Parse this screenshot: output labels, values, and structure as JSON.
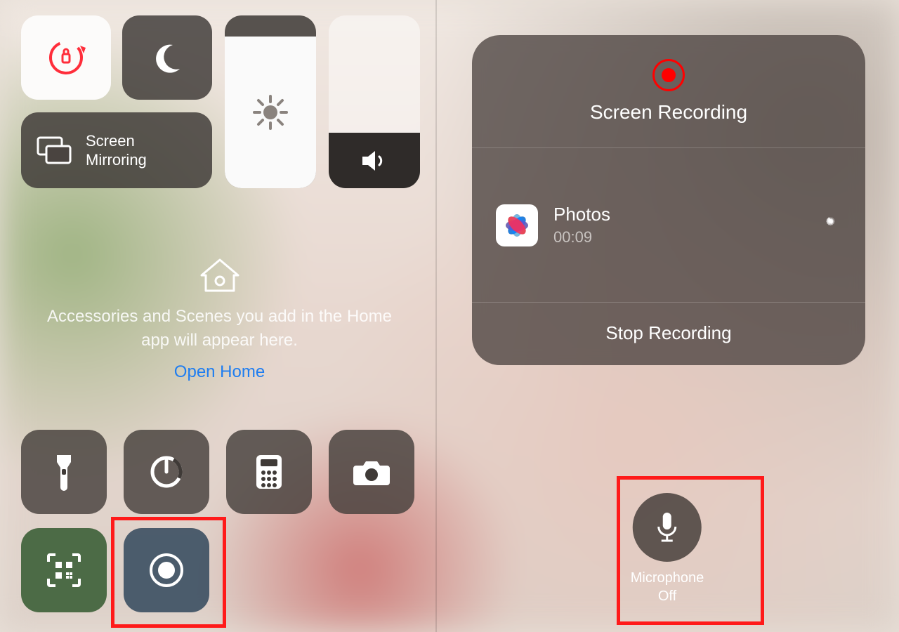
{
  "controlCenter": {
    "screenMirroringLabel": "Screen\nMirroring",
    "home": {
      "message": "Accessories and Scenes you add in the Home app will appear here.",
      "link": "Open Home"
    }
  },
  "recording": {
    "title": "Screen Recording",
    "destination": {
      "appName": "Photos",
      "elapsed": "00:09"
    },
    "stopLabel": "Stop Recording"
  },
  "microphone": {
    "label": "Microphone",
    "state": "Off"
  },
  "colors": {
    "highlight": "#ff1a1a",
    "recordRed": "#ff0000",
    "link": "#1e7df0"
  }
}
